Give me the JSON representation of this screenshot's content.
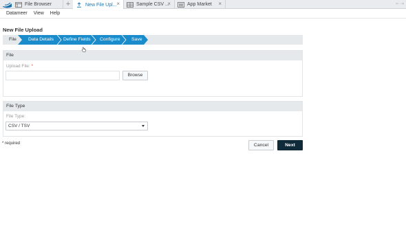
{
  "tabs": [
    {
      "label": "File Browser",
      "icon": "file-browser-icon",
      "active": false
    },
    {
      "label": "New File Upl...",
      "icon": "upload-icon",
      "active": true
    },
    {
      "label": "Sample CSV ...",
      "icon": "table-icon",
      "active": false
    },
    {
      "label": "App Market",
      "icon": "grid-icon",
      "active": false
    }
  ],
  "tab_add_label": "+",
  "tab_close_label": "×",
  "window_control": "⇤ ⇥",
  "menu": [
    "Datameer",
    "View",
    "Help"
  ],
  "page_title": "New File Upload",
  "wizard": {
    "steps": [
      {
        "label": "File",
        "active": false
      },
      {
        "label": "Data Details",
        "active": true
      },
      {
        "label": "Define Fields",
        "active": true
      },
      {
        "label": "Configure",
        "active": true
      },
      {
        "label": "Save",
        "active": true
      }
    ],
    "active_color": "#1a8ccc",
    "inactive_color": "#e6e9ec"
  },
  "file_section": {
    "title": "File",
    "upload_label": "Upload File:",
    "required_marker": "*",
    "upload_value": "",
    "browse_label": "Browse"
  },
  "file_type_section": {
    "title": "File Type",
    "type_label": "File Type:",
    "selected": "CSV / TSV"
  },
  "required_note": "* required",
  "cancel_label": "Cancel",
  "next_label": "Next",
  "colors": {
    "accent": "#1a8ccc",
    "next_button": "#0f2b3a"
  }
}
